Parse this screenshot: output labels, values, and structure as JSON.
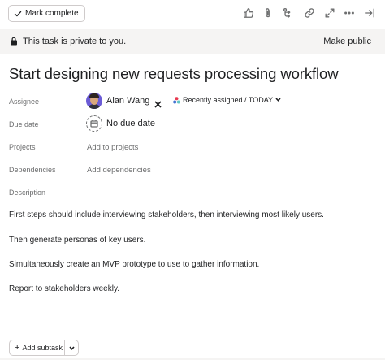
{
  "toolbar": {
    "mark_complete_label": "Mark complete",
    "icons": [
      "thumbs-up-icon",
      "paperclip-icon",
      "subtask-icon",
      "link-icon",
      "expand-icon",
      "more-icon",
      "close-panel-icon"
    ]
  },
  "banner": {
    "private_text": "This task is private to you.",
    "make_public_label": "Make public"
  },
  "task": {
    "title": "Start designing new requests processing workflow"
  },
  "fields": {
    "assignee": {
      "label": "Assignee",
      "name": "Alan Wang",
      "recent_label": "Recently assigned / TODAY"
    },
    "due_date": {
      "label": "Due date",
      "value": "No due date"
    },
    "projects": {
      "label": "Projects",
      "value": "Add to projects"
    },
    "dependencies": {
      "label": "Dependencies",
      "value": "Add dependencies"
    },
    "description": {
      "label": "Description"
    }
  },
  "description": {
    "paragraphs": [
      "First steps should include interviewing stakeholders, then interviewing most likely users.",
      "Then generate personas of key users.",
      "Simultaneously create an MVP prototype to use to gather information.",
      "Report to stakeholders weekly."
    ]
  },
  "subtask": {
    "add_label": "Add subtask"
  },
  "colors": {
    "banner_bg": "#f5f4f3",
    "text_primary": "#1e1f21",
    "text_secondary": "#6d6e6f",
    "avatar_bg": "#6b5bd6"
  }
}
